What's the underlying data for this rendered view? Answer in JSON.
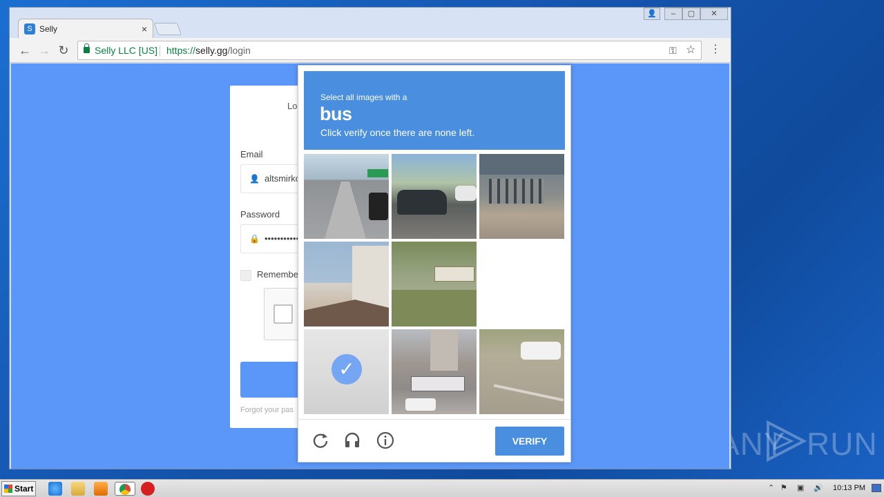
{
  "browser": {
    "tab_title": "Selly",
    "tab_favicon_glyph": "S",
    "close_tab_glyph": "×",
    "back_glyph": "←",
    "forward_glyph": "→",
    "reload_glyph": "↻",
    "secure_label": "Selly LLC [US]",
    "url_scheme": "https://",
    "url_host": "selly.gg",
    "url_path": "/login",
    "key_icon_glyph": "⚿",
    "star_icon_glyph": "☆",
    "menu_glyph": "⋮",
    "window_controls": [
      "👤",
      "–",
      "▢",
      "✕"
    ]
  },
  "login": {
    "title": "Log",
    "email_label": "Email",
    "email_value": "altsmirkc",
    "password_label": "Password",
    "password_value": "•••••••••••",
    "remember_label": "Remember",
    "forgot_text": "Forgot your pas"
  },
  "captcha": {
    "instruction_line1": "Select all images with a",
    "target": "bus",
    "instruction_line2": "Click verify once there are none left.",
    "verify_label": "VERIFY",
    "check_glyph": "✓",
    "tiles": [
      {
        "content": "highway-road",
        "selected": false
      },
      {
        "content": "parked-cars",
        "selected": false
      },
      {
        "content": "bike-rack",
        "selected": false
      },
      {
        "content": "house-roof",
        "selected": false
      },
      {
        "content": "bus-in-field",
        "selected": false
      },
      {
        "content": "blank-loading",
        "selected": false
      },
      {
        "content": "road-faded",
        "selected": true
      },
      {
        "content": "city-bus",
        "selected": false
      },
      {
        "content": "parking-lot",
        "selected": false
      }
    ],
    "colors": {
      "accent": "#4a8ee0",
      "page_background": "#5b97f8"
    }
  },
  "taskbar": {
    "start_label": "Start",
    "clock": "10:13 PM",
    "tray_glyphs": [
      "⌃",
      "⚑",
      "▣",
      "🔊"
    ]
  },
  "watermark": {
    "left": "ANY",
    "right": "RUN"
  }
}
